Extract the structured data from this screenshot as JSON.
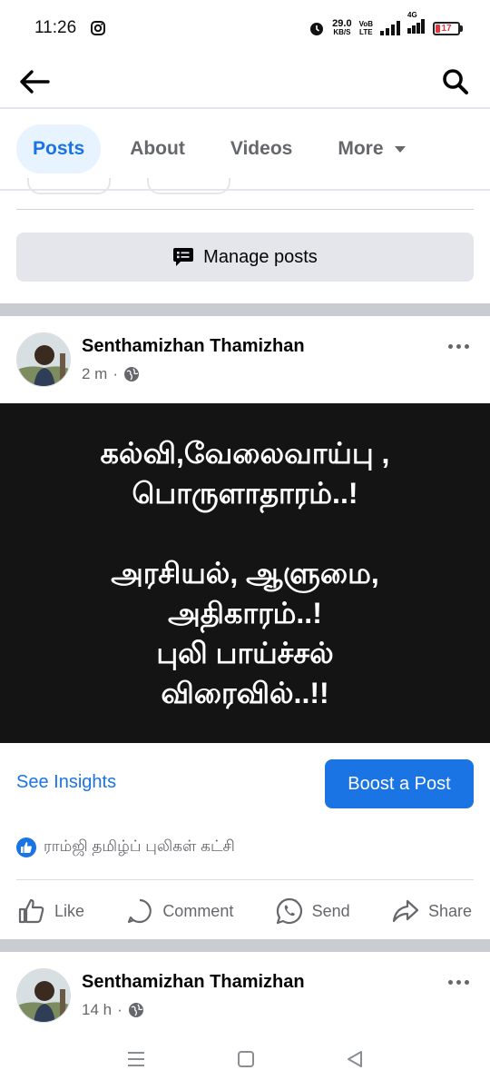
{
  "status_bar": {
    "time": "11:26",
    "net_speed_value": "29.0",
    "net_speed_unit": "KB/S",
    "volte_top": "VoB",
    "volte_bottom": "LTE",
    "network_type": "4G",
    "battery_level": "17",
    "battery_color": "#e0383e"
  },
  "tabs": [
    {
      "label": "Posts",
      "active": true
    },
    {
      "label": "About",
      "active": false
    },
    {
      "label": "Videos",
      "active": false
    },
    {
      "label": "More",
      "active": false
    }
  ],
  "manage_posts": {
    "label": "Manage posts"
  },
  "posts": [
    {
      "author": "Senthamizhan Thamizhan",
      "time": "2 m",
      "separator": "·",
      "image_text": {
        "line1": "கல்வி,வேலைவாய்பு ,",
        "line2": "பொருளாதாரம்..!",
        "line3": "அரசியல், ஆளுமை,",
        "line4": "அதிகாரம்..!",
        "line5": "புலி பாய்ச்சல்",
        "line6": "விரைவில்..!!"
      },
      "see_insights": "See Insights",
      "boost": "Boost a Post",
      "reaction_by": "ராம்ஜி தமிழ்ப் புலிகள் கட்சி",
      "actions": {
        "like": "Like",
        "comment": "Comment",
        "send": "Send",
        "share": "Share"
      }
    },
    {
      "author": "Senthamizhan Thamizhan",
      "time": "14 h",
      "separator": "·"
    }
  ],
  "colors": {
    "accent": "#1b74e4",
    "secondary_text": "#65676b",
    "button_bg": "#e4e6eb"
  }
}
